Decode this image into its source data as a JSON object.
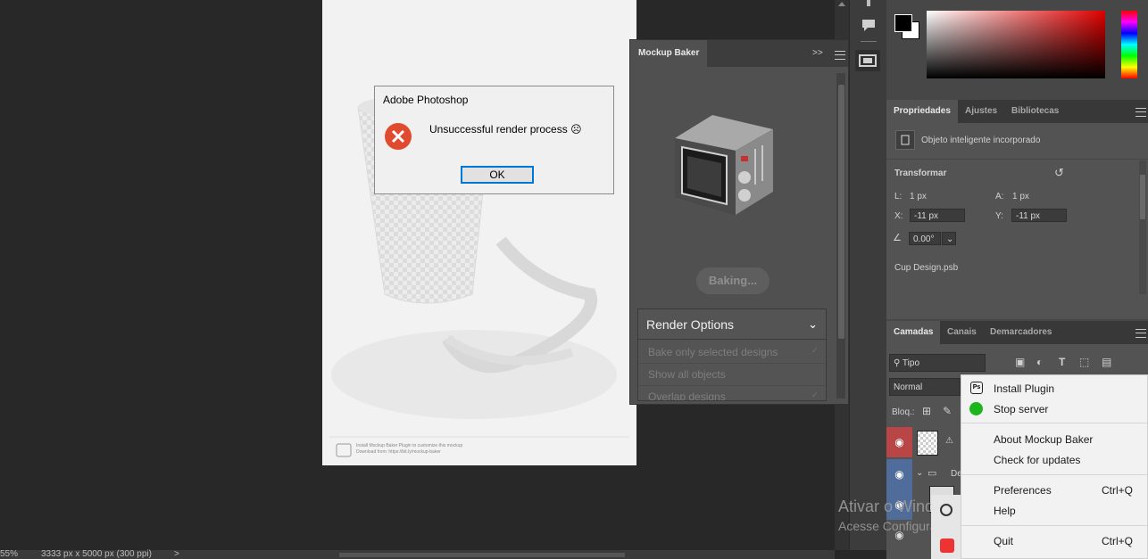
{
  "status_bar": {
    "zoom": "55%",
    "doc_size": "3333 px x 5000 px (300 ppi)",
    "nav_arrow": ">"
  },
  "document": {
    "footer_line1": "Install Mockup Baker Plugin to customize this mockup",
    "footer_line2": "Download from: https://bit.ly/mockup-baker"
  },
  "dialog": {
    "title": "Adobe Photoshop",
    "message": "Unsuccessful render process ☹",
    "ok_label": "OK"
  },
  "mockup_baker": {
    "tab_label": "Mockup Baker",
    "expand_glyph": ">>",
    "baking_label": "Baking...",
    "render_options_title": "Render Options",
    "options": [
      {
        "label": "Bake only selected designs",
        "checked": true
      },
      {
        "label": "Show all objects",
        "checked": false
      },
      {
        "label": "Overlap designs",
        "checked": true
      }
    ]
  },
  "properties": {
    "tabs": [
      "Propriedades",
      "Ajustes",
      "Bibliotecas"
    ],
    "object_type": "Objeto inteligente incorporado",
    "transform_label": "Transformar",
    "w_label": "L:",
    "w_value": "1 px",
    "h_label": "A:",
    "h_value": "1 px",
    "x_label": "X:",
    "x_value": "-11 px",
    "y_label": "Y:",
    "y_value": "-11 px",
    "angle_value": "0.00°",
    "linked_file": "Cup Design.psb"
  },
  "layers": {
    "tabs": [
      "Camadas",
      "Canais",
      "Demarcadores"
    ],
    "filter_label": "Tipo",
    "blend_mode": "Normal",
    "lock_label": "Bloq.:",
    "group_name_partial": "De"
  },
  "context_menu": {
    "items": [
      {
        "label": "Install Plugin",
        "shortcut": ""
      },
      {
        "label": "Stop server",
        "shortcut": ""
      },
      {
        "label": "About Mockup Baker",
        "shortcut": ""
      },
      {
        "label": "Check for updates",
        "shortcut": ""
      },
      {
        "label": "Preferences",
        "shortcut": "Ctrl+Q"
      },
      {
        "label": "Help",
        "shortcut": ""
      },
      {
        "label": "Quit",
        "shortcut": "Ctrl+Q"
      }
    ]
  },
  "watermark": {
    "line1": "Ativar o Windows",
    "line2": "Acesse Configurações para ativar o Windows."
  },
  "colors": {
    "accent_blue": "#0078d7",
    "error_red": "#e04a2f",
    "server_green": "#1eb41e",
    "layer_red": "#b84646",
    "layer_blue": "#4f6c9a"
  }
}
